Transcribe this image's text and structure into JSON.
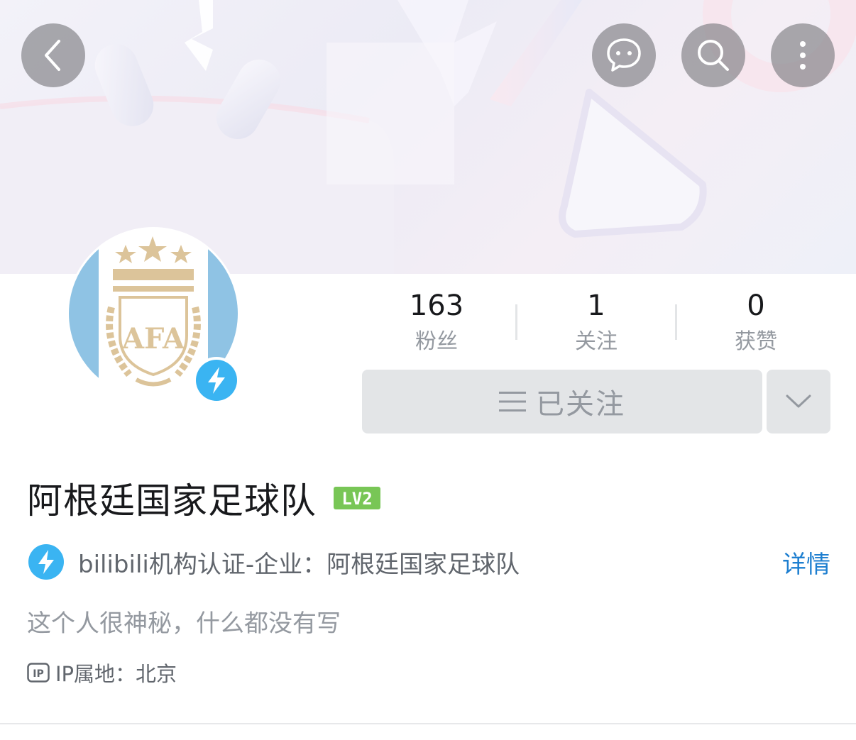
{
  "header": {
    "back_icon": "back-arrow-icon",
    "message_icon": "chat-bubble-icon",
    "search_icon": "search-icon",
    "more_icon": "more-vertical-icon"
  },
  "profile": {
    "avatar_icon": "afa-crest-logo",
    "avatar_text": "AFA",
    "name": "阿根廷国家足球队",
    "level": "LV2",
    "level_color": "#78c656"
  },
  "stats": [
    {
      "value": "163",
      "label": "粉丝"
    },
    {
      "value": "1",
      "label": "关注"
    },
    {
      "value": "0",
      "label": "获赞"
    }
  ],
  "actions": {
    "follow_label": "已关注",
    "follow_icon": "menu-lines-icon",
    "dropdown_icon": "chevron-down-icon"
  },
  "certification": {
    "icon": "lightning-badge-icon",
    "badge_color": "#3ab4f2",
    "text": "bilibili机构认证-企业：阿根廷国家足球队",
    "detail_link": "详情"
  },
  "sign": "这个人很神秘，什么都没有写",
  "ip": {
    "icon": "ip-icon",
    "label": "IP属地：北京"
  },
  "colors": {
    "accent_link": "#1e7fd0",
    "secondary_text": "#9499a0",
    "button_bg": "#e3e5e7"
  }
}
